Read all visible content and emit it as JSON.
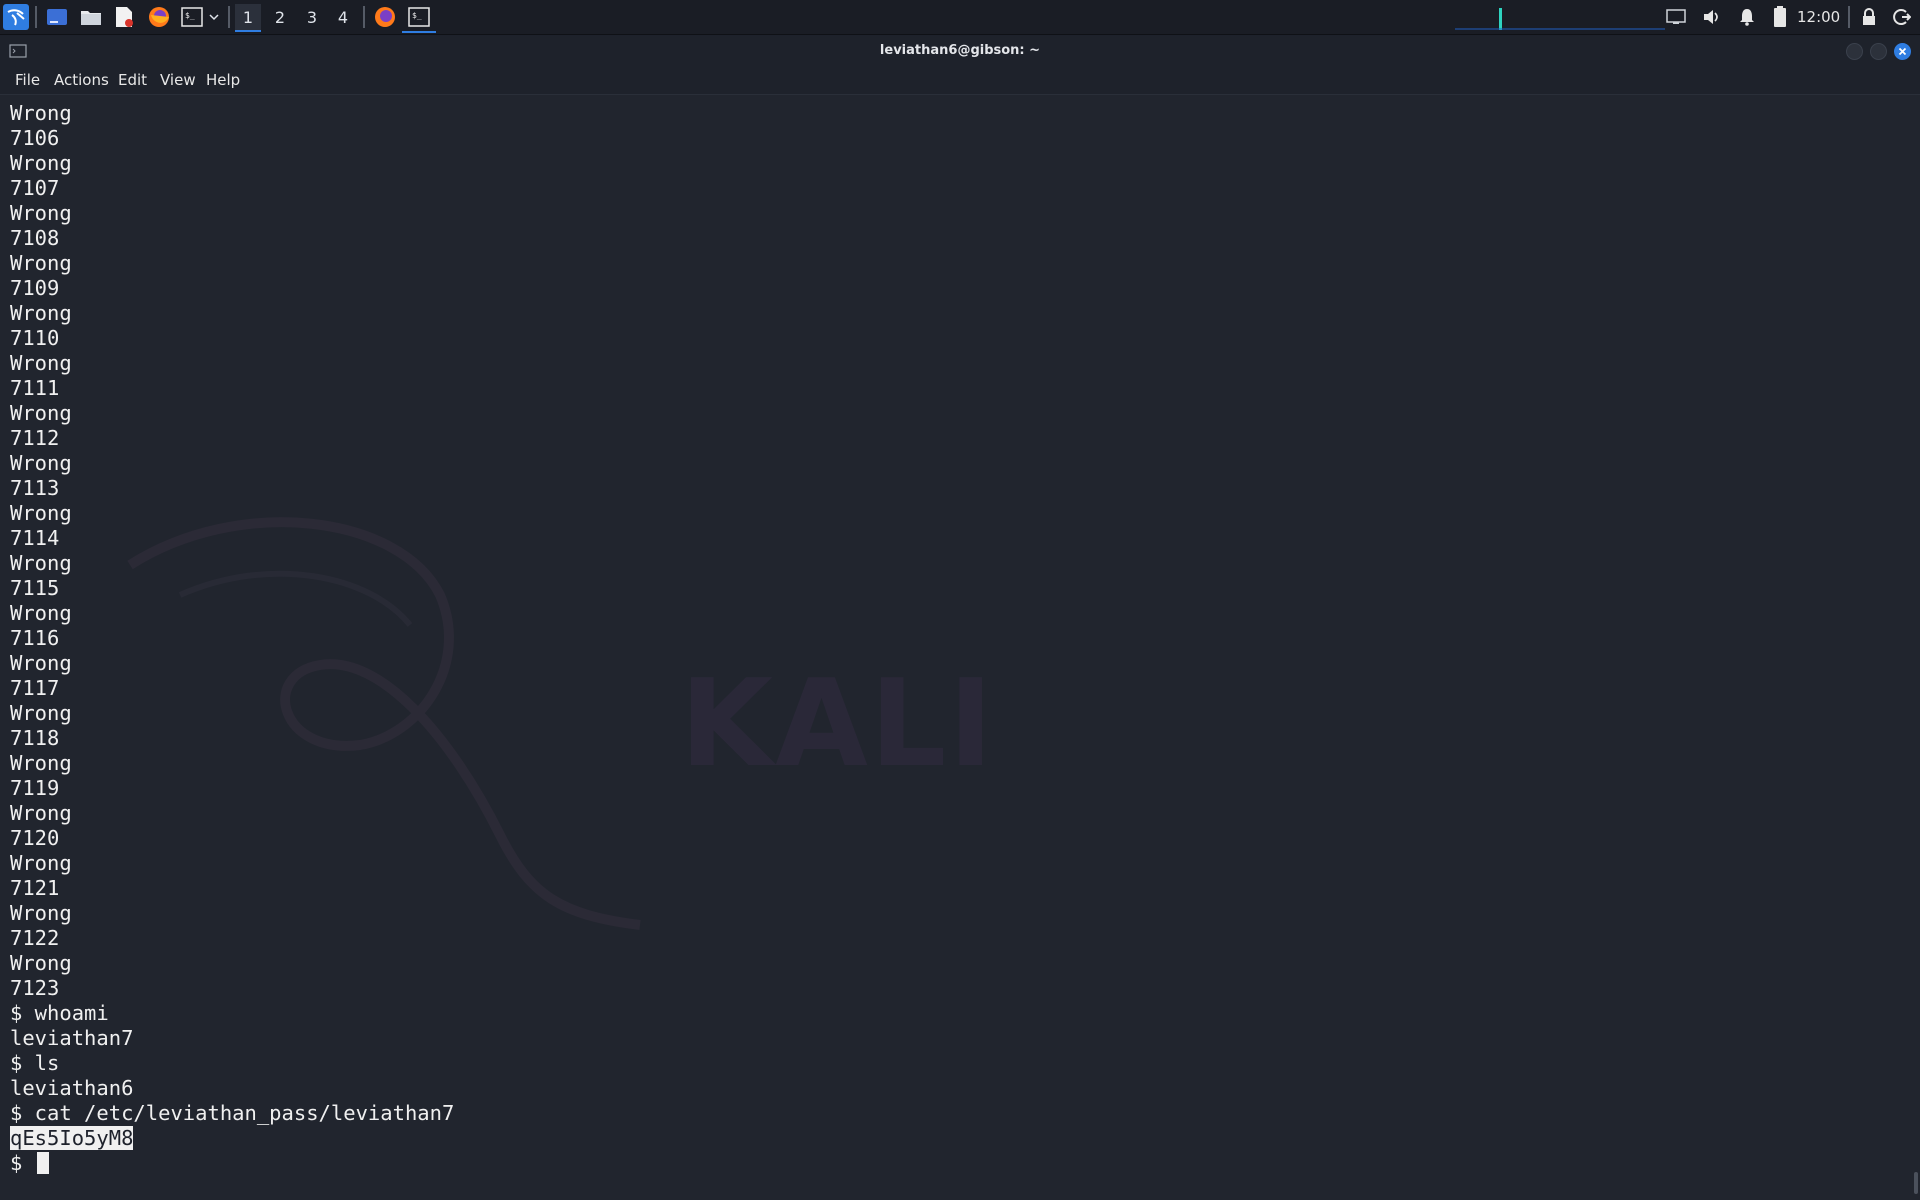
{
  "panel": {
    "workspaces": [
      "1",
      "2",
      "3",
      "4"
    ],
    "active_workspace": "1",
    "clock": "12:00",
    "accent": "#2f7de1"
  },
  "window": {
    "title": "leviathan6@gibson: ~"
  },
  "menubar": {
    "items": [
      "File",
      "Actions",
      "Edit",
      "View",
      "Help"
    ]
  },
  "terminal": {
    "lines": [
      "Wrong",
      "7106",
      "Wrong",
      "7107",
      "Wrong",
      "7108",
      "Wrong",
      "7109",
      "Wrong",
      "7110",
      "Wrong",
      "7111",
      "Wrong",
      "7112",
      "Wrong",
      "7113",
      "Wrong",
      "7114",
      "Wrong",
      "7115",
      "Wrong",
      "7116",
      "Wrong",
      "7117",
      "Wrong",
      "7118",
      "Wrong",
      "7119",
      "Wrong",
      "7120",
      "Wrong",
      "7121",
      "Wrong",
      "7122",
      "Wrong",
      "7123",
      "$ whoami",
      "leviathan7",
      "$ ls",
      "leviathan6",
      "$ cat /etc/leviathan_pass/leviathan7"
    ],
    "selected_output": "qEs5Io5yM8",
    "prompt": "$ "
  },
  "wallpaper": {
    "watermark": "KALI"
  }
}
